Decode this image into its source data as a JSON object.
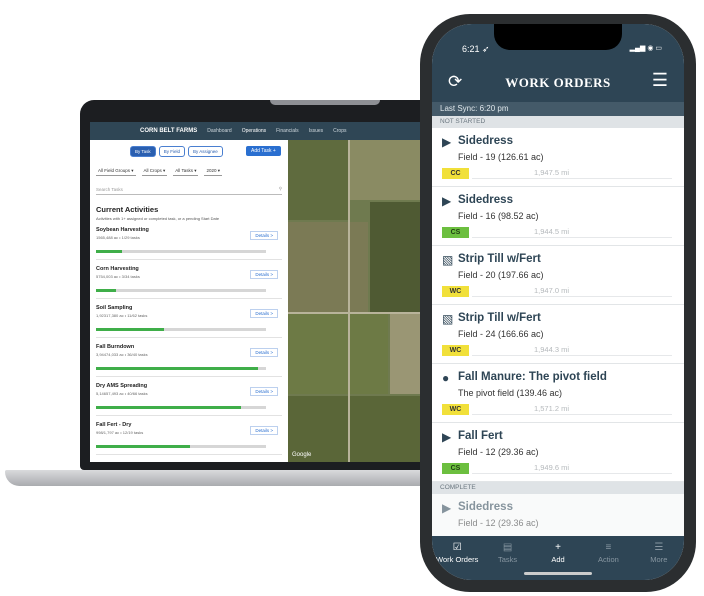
{
  "laptop": {
    "nav": {
      "brand": "CORN BELT FARMS",
      "items": [
        "Dashboard",
        "Operations",
        "Financials",
        "Issues",
        "Crops"
      ],
      "active": "Operations"
    },
    "toggles": [
      "By Task",
      "By Field",
      "By Assignee"
    ],
    "add_task": "Add Task +",
    "filters": [
      "All Field Groups ▾",
      "All Crops ▾",
      "All Tasks ▾",
      "2020 ▾"
    ],
    "search_placeholder": "Search Tasks",
    "title": "Current Activities",
    "subtitle": "Activities with 1+ assigned or completed task, or a pending Start Date",
    "activities": [
      {
        "name": "Soybean Harvesting",
        "stats": "1565,488 ac • 1/29 tasks",
        "progress": 0.15
      },
      {
        "name": "Corn Harvesting",
        "stats": "5754,003 ac • 3/34 tasks",
        "progress": 0.12
      },
      {
        "name": "Soil Sampling",
        "stats": "1,92317,380 ac • 11/62 tasks",
        "progress": 0.4
      },
      {
        "name": "Fall Burndown",
        "stats": "3,94474,033 ac • 36/40 tasks",
        "progress": 0.95
      },
      {
        "name": "Dry AMS Spreading",
        "stats": "5,14657,493 ac • 40/66 tasks",
        "progress": 0.85
      },
      {
        "name": "Fall Fert - Dry",
        "stats": "998/1,797 ac • 12/19 tasks",
        "progress": 0.55
      }
    ],
    "details_label": "Details >",
    "map_label": "Google"
  },
  "phone": {
    "time": "6:21 ➶",
    "signal": "▂▄▆ ◉ ▭",
    "title": "WORK ORDERS",
    "last_sync": "Last Sync: 6:20 pm",
    "not_started_label": "NOT STARTED",
    "complete_label": "COMPLETE",
    "orders": [
      {
        "title": "Sidedress",
        "field": "Field - 19 (126.61 ac)",
        "tag": "CC",
        "tag_bg": "#f1e03a",
        "tag_fg": "#333333",
        "distance": "1,947.5 mi",
        "icon": "▶"
      },
      {
        "title": "Sidedress",
        "field": "Field - 16 (98.52 ac)",
        "tag": "CS",
        "tag_bg": "#6cbf3f",
        "tag_fg": "#1f3d12",
        "distance": "1,944.5 mi",
        "icon": "▶"
      },
      {
        "title": "Strip Till w/Fert",
        "field": "Field - 20 (197.66 ac)",
        "tag": "WC",
        "tag_bg": "#f1e03a",
        "tag_fg": "#333333",
        "distance": "1,947.0 mi",
        "icon": "▧"
      },
      {
        "title": "Strip Till w/Fert",
        "field": "Field - 24 (166.66 ac)",
        "tag": "WC",
        "tag_bg": "#f1e03a",
        "tag_fg": "#333333",
        "distance": "1,944.3 mi",
        "icon": "▧"
      },
      {
        "title": "Fall Manure: The pivot field",
        "field": "The pivot field (139.46 ac)",
        "tag": "WC",
        "tag_bg": "#f1e03a",
        "tag_fg": "#333333",
        "distance": "1,571.2 mi",
        "icon": "●"
      },
      {
        "title": "Fall Fert",
        "field": "Field - 12 (29.36 ac)",
        "tag": "CS",
        "tag_bg": "#6cbf3f",
        "tag_fg": "#1f3d12",
        "distance": "1,949.6 mi",
        "icon": "▶"
      }
    ],
    "complete_order": {
      "title": "Sidedress",
      "field": "Field - 12 (29.36 ac)",
      "icon": "▶"
    },
    "tabs": [
      {
        "label": "Work Orders",
        "icon": "☑",
        "active": true
      },
      {
        "label": "Tasks",
        "icon": "▤",
        "active": false
      },
      {
        "label": "Add",
        "icon": "+",
        "active": false
      },
      {
        "label": "Action",
        "icon": "≡",
        "active": false
      },
      {
        "label": "More",
        "icon": "☰",
        "active": false
      }
    ],
    "colors": {
      "header": "#2e4555",
      "tag_yellow": "#f1e03a",
      "tag_green": "#6cbf3f"
    }
  }
}
